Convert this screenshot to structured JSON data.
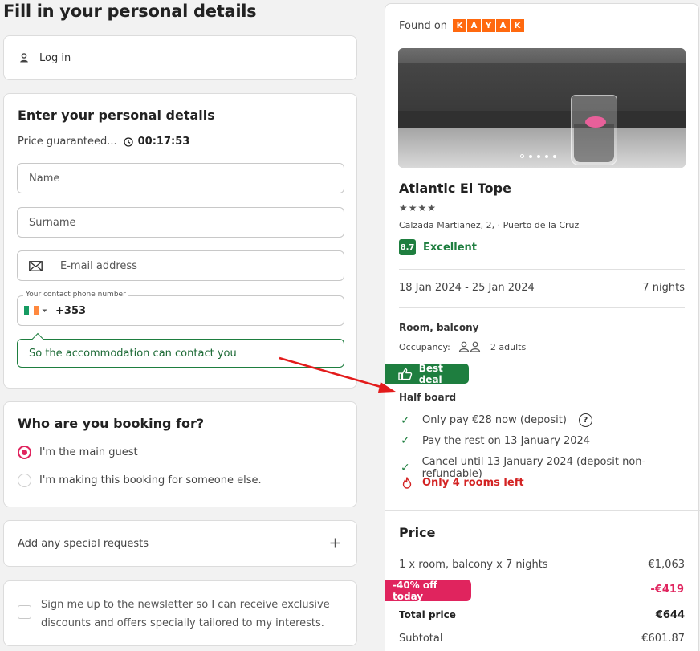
{
  "page": {
    "title": "Fill in your personal details"
  },
  "login": {
    "label": "Log in",
    "icon": "person-icon"
  },
  "details": {
    "title": "Enter your personal details",
    "guaranteed_label": "Price guaranteed...",
    "timer": "00:17:53",
    "name_placeholder": "Name",
    "surname_placeholder": "Surname",
    "email_placeholder": "E-mail address",
    "phone_label": "Your contact phone number",
    "phone_code": "+353",
    "phone_hint": "So the accommodation can contact you",
    "flag_colors": [
      "#169b62",
      "#ffffff",
      "#ff883e"
    ]
  },
  "booking_for": {
    "title": "Who are you booking for?",
    "options": [
      {
        "label": "I'm the main guest",
        "selected": true
      },
      {
        "label": "I'm making this booking for someone else.",
        "selected": false
      }
    ]
  },
  "special_requests": {
    "label": "Add any special requests",
    "icon": "plus-icon"
  },
  "newsletter": {
    "line1": "Sign me up to the newsletter so I can receive exclusive",
    "line2": "discounts and offers specially tailored to my interests."
  },
  "summary": {
    "found_on": "Found on",
    "source_letters": [
      "K",
      "A",
      "Y",
      "A",
      "K"
    ],
    "hotel_name": "Atlantic El Tope",
    "stars": "★★★★",
    "address": "Calzada Martianez, 2, · Puerto de la Cruz",
    "score": "8.7",
    "rating_text": "Excellent",
    "dates": "18 Jan 2024 - 25 Jan 2024",
    "nights": "7 nights",
    "room": "Room, balcony",
    "occupancy_label": "Occupancy:",
    "occupancy_value": "2 adults",
    "best_deal": "Best deal",
    "board": "Half board",
    "perks": [
      "Only pay €28 now (deposit)",
      "Pay the rest on 13 January 2024",
      "Cancel until 13 January 2024 (deposit non-refundable)"
    ],
    "rooms_left": "Only 4 rooms left",
    "help_mark": "?"
  },
  "price": {
    "title": "Price",
    "room_line": "1 x room, balcony x 7 nights",
    "room_amount": "€1,063",
    "discount_label": "-40% off today",
    "discount_amount": "-€419",
    "total_label": "Total price",
    "total_amount": "€644",
    "subtotal_label": "Subtotal",
    "subtotal_amount": "€601.87"
  },
  "colors": {
    "accent_pink": "#e0245e",
    "green": "#1e7e3f",
    "kayak_orange": "#ff690f",
    "annotation_red": "#e31b1b"
  }
}
